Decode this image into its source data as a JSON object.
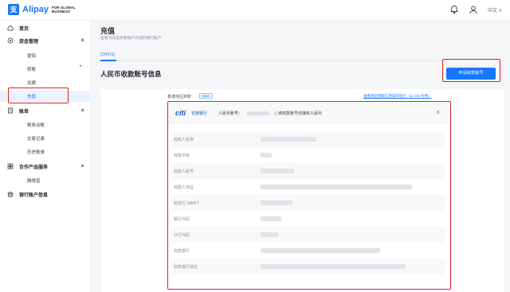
{
  "header": {
    "logo_mark": "支",
    "logo_text": "Alipay",
    "logo_sub": "FOR GLOBAL BUSINESS",
    "language": "中文 ∨"
  },
  "sidebar": {
    "groups": [
      {
        "label": "首页",
        "icon": "home-icon"
      },
      {
        "label": "资金管理",
        "icon": "wallet-icon",
        "chevron": "∧"
      },
      {
        "label": "账单",
        "icon": "bill-icon",
        "chevron": "∧"
      },
      {
        "label": "合作产品服务",
        "icon": "grid-icon",
        "chevron": "∧"
      },
      {
        "label": "银行账户信息",
        "icon": "bank-icon"
      }
    ],
    "items": [
      {
        "label": "提现"
      },
      {
        "label": "转账",
        "badge": "•"
      },
      {
        "label": "兑换"
      },
      {
        "label": "充值"
      },
      {
        "label": "账务动账"
      },
      {
        "label": "交易记录"
      },
      {
        "label": "历史账单"
      },
      {
        "label": "跨境宝"
      }
    ]
  },
  "main": {
    "title": "充值",
    "description": "查看可向您余额账户充值的银行账户",
    "tab": "CNY(1)",
    "section_title": "人民币收款账号信息",
    "apply_button": "申请收款账号",
    "hk_label": "香港地区转账",
    "new_badge": "NEW",
    "hk_link": "查看地区网银汇款操作指引（以 Citi 为例）",
    "bank_logo": "citi",
    "bank_name": "花旗银行",
    "account_number_label": "人民币账号：",
    "account_note": "ⓘ该收款账号仅接收人民币",
    "collapse": "∧",
    "rows": [
      {
        "label": "收款人名称"
      },
      {
        "label": "收款币种"
      },
      {
        "label": "收款人账号"
      },
      {
        "label": "收款人地址"
      },
      {
        "label": "收款行 SWIFT"
      },
      {
        "label": "银行代码"
      },
      {
        "label": "分行代码"
      },
      {
        "label": "收款银行"
      },
      {
        "label": "收款银行地址"
      }
    ]
  },
  "colors": {
    "accent": "#1677ff",
    "highlight": "#e02020"
  }
}
